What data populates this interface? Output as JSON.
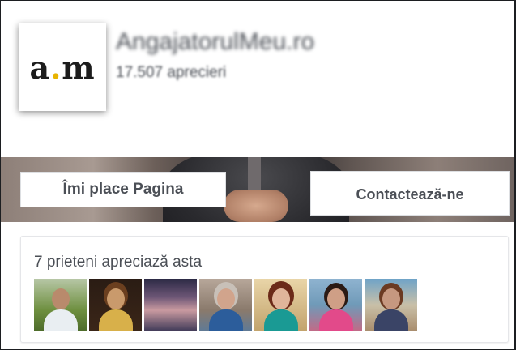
{
  "page": {
    "name": "AngajatorulMeu.ro",
    "likes": "17.507 aprecieri",
    "logo_text_a": "a",
    "logo_dot": ".",
    "logo_text_m": "m"
  },
  "buttons": {
    "like": "Îmi place Pagina",
    "contact": "Contactează-ne"
  },
  "friends": {
    "label": "7 prieteni apreciază asta",
    "avatars": [
      "friend-1",
      "friend-2",
      "friend-3",
      "friend-4",
      "friend-5",
      "friend-6",
      "friend-7"
    ]
  },
  "colors": {
    "accent_tick": "#3bb4d8",
    "logo_dot": "#e8b400",
    "text": "#4b4f56"
  }
}
